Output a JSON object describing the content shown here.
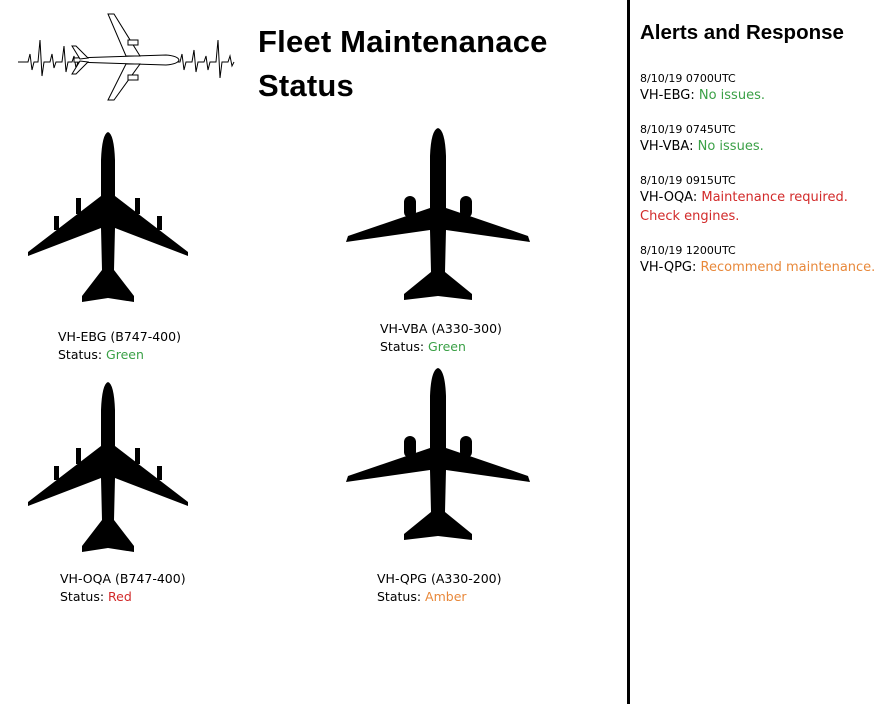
{
  "page": {
    "title_line1": "Fleet Maintenanace",
    "title_line2": "Status"
  },
  "fleet": [
    {
      "registration": "VH-EBG",
      "model": "(B747-400)",
      "status_label": "Status:",
      "status": "Green",
      "status_color": "#3aa046"
    },
    {
      "registration": "VH-VBA",
      "model": "(A330-300)",
      "status_label": "Status:",
      "status": "Green",
      "status_color": "#3aa046"
    },
    {
      "registration": "VH-OQA",
      "model": "(B747-400)",
      "status_label": "Status:",
      "status": "Red",
      "status_color": "#d22a2a"
    },
    {
      "registration": "VH-QPG",
      "model": "(A330-200)",
      "status_label": "Status:",
      "status": "Amber",
      "status_color": "#e8883a"
    }
  ],
  "alerts": {
    "title": "Alerts and Response",
    "items": [
      {
        "time": "8/10/19 0700UTC",
        "registration": "VH-EBG:",
        "message": "No issues.",
        "color": "#3aa046"
      },
      {
        "time": "8/10/19 0745UTC",
        "registration": "VH-VBA:",
        "message": "No issues.",
        "color": "#3aa046"
      },
      {
        "time": "8/10/19 0915UTC",
        "registration": "VH-OQA:",
        "message": "Maintenance required.",
        "message_line2": "Check engines.",
        "color": "#d22a2a"
      },
      {
        "time": "8/10/19 1200UTC",
        "registration": "VH-QPG:",
        "message": "Recommend maintenance.",
        "color": "#e8883a"
      }
    ]
  },
  "icons": {
    "logo": "airplane-heartbeat-logo-icon",
    "b747": "boeing-747-silhouette-icon",
    "a330": "airbus-a330-silhouette-icon"
  }
}
